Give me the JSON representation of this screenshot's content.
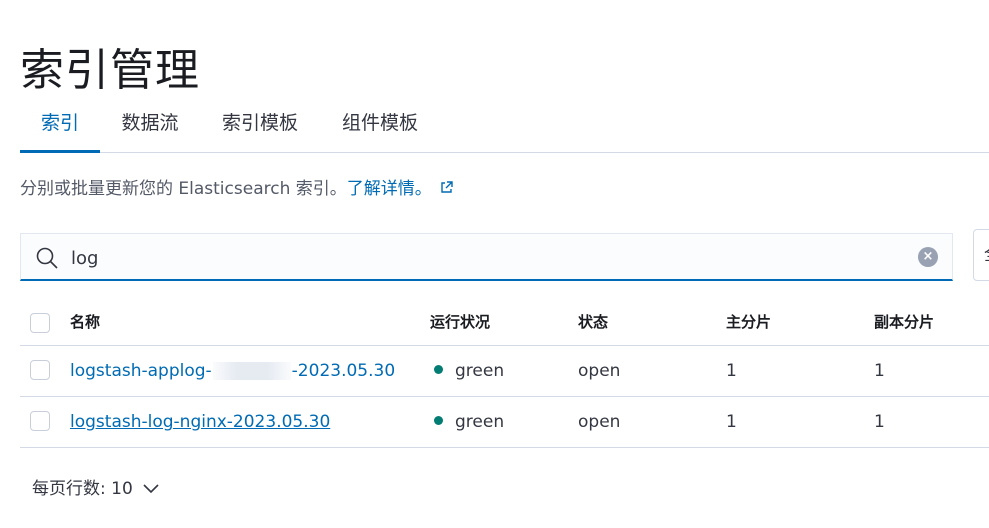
{
  "page": {
    "title": "索引管理"
  },
  "tabs": [
    {
      "label": "索引",
      "active": true
    },
    {
      "label": "数据流",
      "active": false
    },
    {
      "label": "索引模板",
      "active": false
    },
    {
      "label": "组件模板",
      "active": false
    }
  ],
  "description": {
    "text": "分别或批量更新您的 Elasticsearch 索引。",
    "link": "了解详情。"
  },
  "search": {
    "value": "log",
    "side_button_text": "全"
  },
  "table": {
    "headers": {
      "name": "名称",
      "health": "运行状况",
      "status": "状态",
      "primaries": "主分片",
      "replicas": "副本分片"
    },
    "rows": [
      {
        "name_prefix": "logstash-applog-",
        "name_suffix": "-2023.05.30",
        "health": "green",
        "status": "open",
        "primaries": "1",
        "replicas": "1"
      },
      {
        "name": "logstash-log-nginx-2023.05.30",
        "health": "green",
        "status": "open",
        "primaries": "1",
        "replicas": "1"
      }
    ]
  },
  "pagination": {
    "rows_per_page_label": "每页行数: 10"
  },
  "colors": {
    "accent": "#006bb4",
    "health_green": "#017d73",
    "border": "#d3dae6"
  }
}
